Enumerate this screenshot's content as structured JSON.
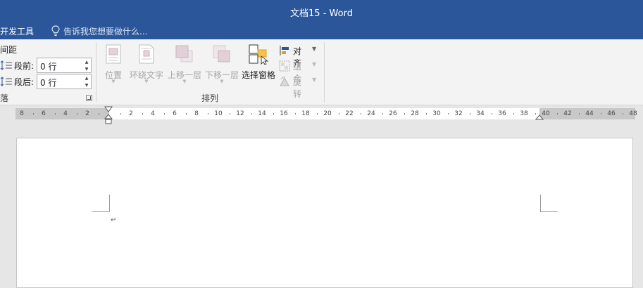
{
  "window": {
    "title": "文档15 - Word"
  },
  "tellbar": {
    "dev_tab": "开发工具",
    "tell_placeholder": "告诉我您想要做什么..."
  },
  "ribbon": {
    "paragraph": {
      "spacing_title": "间距",
      "before_label": "段前:",
      "before_value": "0 行",
      "after_label": "段后:",
      "after_value": "0 行",
      "group_label": "落"
    },
    "arrange": {
      "position_label": "位置",
      "wrap_text_label": "环绕文字",
      "bring_forward_label": "上移一层",
      "send_backward_label": "下移一层",
      "selection_pane_label": "选择窗格",
      "align_label": "对齐",
      "group_btn_label": "组合",
      "rotate_label": "旋转",
      "group_label": "排列"
    }
  },
  "ruler": {
    "left_labels": [
      "8",
      "6",
      "4",
      "2"
    ],
    "main_labels": [
      "2",
      "4",
      "6",
      "8",
      "10",
      "12",
      "14",
      "16",
      "18",
      "20",
      "22",
      "24",
      "26",
      "28",
      "30",
      "32",
      "34",
      "36",
      "38"
    ],
    "right_labels": [
      "40",
      "42",
      "44",
      "46",
      "48"
    ]
  },
  "document": {
    "paragraph_mark": "↵"
  },
  "colors": {
    "titlebar": "#2b579a",
    "ribbon": "#f3f3f3",
    "workspace": "#e6e6e6"
  }
}
